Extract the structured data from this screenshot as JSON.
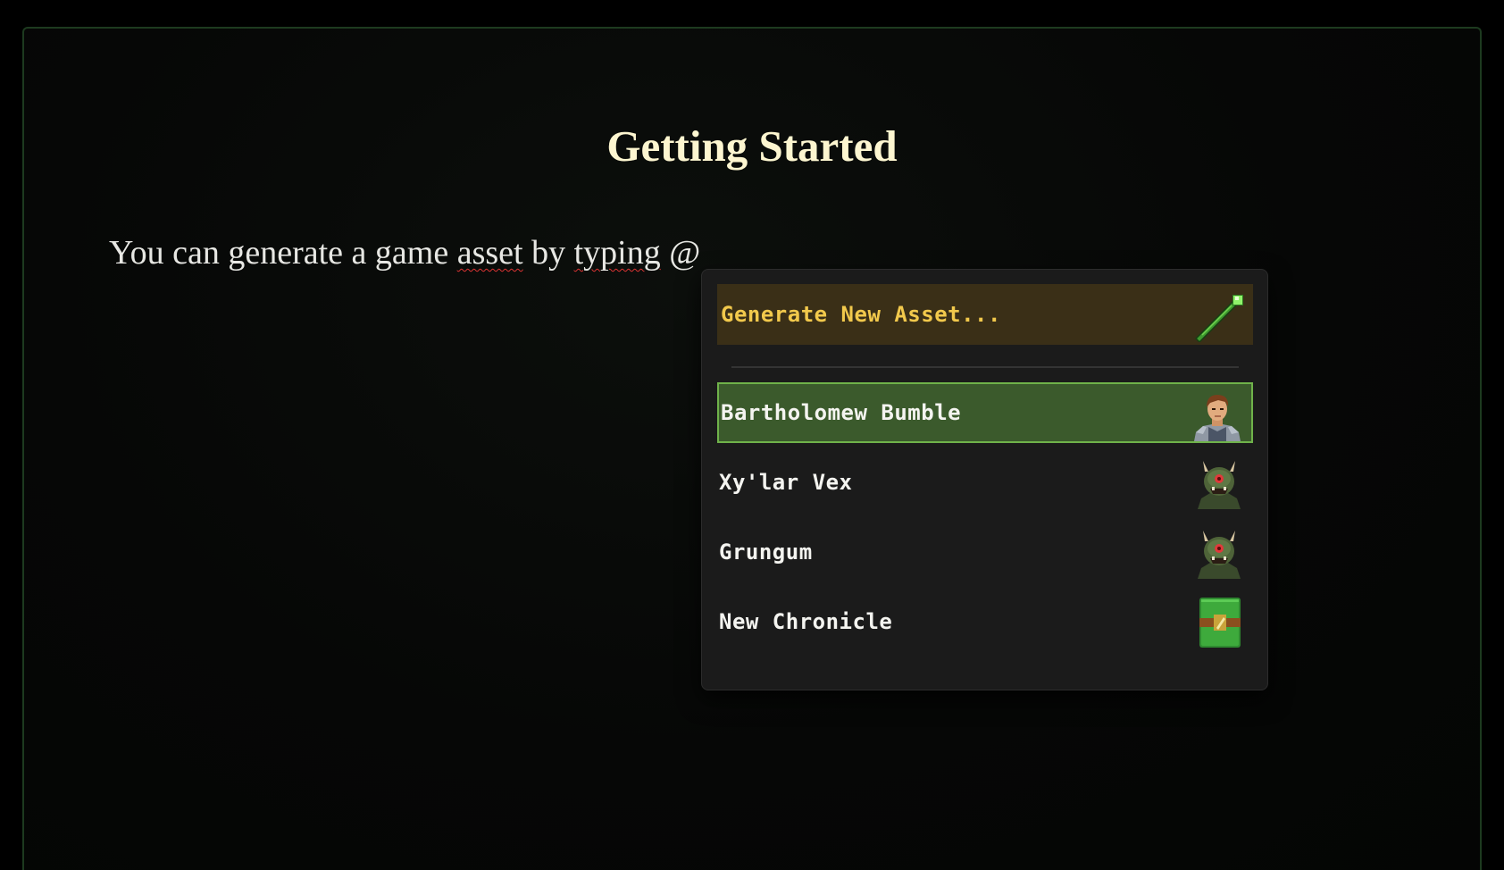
{
  "document": {
    "title": "Getting Started",
    "paragraph": {
      "part1": "You can generate a game ",
      "word_asset": "asset",
      "part2": " by ",
      "word_typing": "typing",
      "part3": " @"
    }
  },
  "mention_menu": {
    "generate_label": "Generate New Asset...",
    "generate_icon": "magic-wand-icon",
    "items": [
      {
        "label": "Bartholomew Bumble",
        "icon": "human-character-icon",
        "selected": true
      },
      {
        "label": "Xy'lar Vex",
        "icon": "orc-character-icon",
        "selected": false
      },
      {
        "label": "Grungum",
        "icon": "orc-character-icon",
        "selected": false
      },
      {
        "label": "New Chronicle",
        "icon": "chronicle-book-icon",
        "selected": false
      }
    ]
  },
  "colors": {
    "title_text": "#fdf6d0",
    "generate_bg": "#3a2f17",
    "generate_text": "#f2c94c",
    "selected_bg": "#3b5a2c",
    "selected_border": "#6fb24a",
    "menu_bg": "#1b1b1b"
  }
}
